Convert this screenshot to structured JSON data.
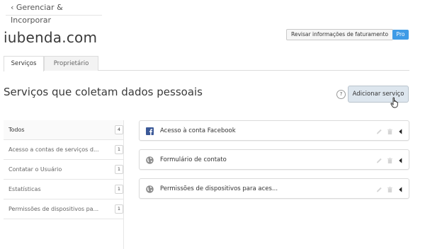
{
  "nav": {
    "back_label": "‹ Gerenciar & Incorporar"
  },
  "site": {
    "title": "iubenda.com"
  },
  "header": {
    "billing_button": "Revisar informações de faturamento",
    "plan_badge": "Pro"
  },
  "tabs": [
    {
      "label": "Serviços",
      "active": true
    },
    {
      "label": "Proprietário",
      "active": false
    }
  ],
  "section": {
    "title": "Serviços que coletam dados pessoais",
    "help": "?",
    "add_button": "Adicionar serviço"
  },
  "sidebar": {
    "items": [
      {
        "label": "Todos",
        "count": "4"
      },
      {
        "label": "Acesso a contas de serviços d...",
        "count": "1"
      },
      {
        "label": "Contatar o Usuário",
        "count": "1"
      },
      {
        "label": "Estatísticas",
        "count": "1"
      },
      {
        "label": "Permissões de dispositivos pa...",
        "count": "1"
      }
    ]
  },
  "services": [
    {
      "name": "Acesso à conta Facebook",
      "icon": "facebook-icon"
    },
    {
      "name": "Formulário de contato",
      "icon": "globe-icon"
    },
    {
      "name": "Permissões de dispositivos para aces...",
      "icon": "globe-icon"
    }
  ],
  "colors": {
    "accent": "#3f9be6",
    "button_bg": "#dde6ee",
    "facebook": "#3b5998"
  }
}
